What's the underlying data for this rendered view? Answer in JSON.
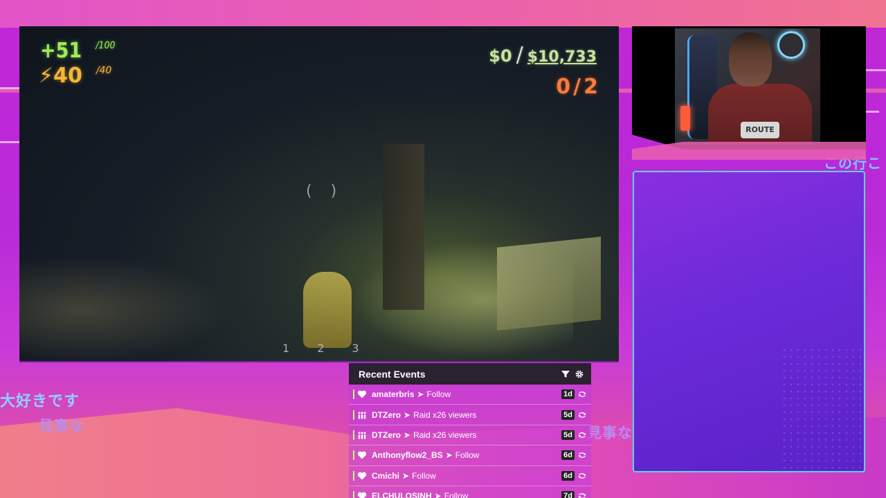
{
  "background": {
    "japanese_texts": [
      "この行こ",
      "大好きです",
      "見事な",
      "見事な"
    ]
  },
  "game": {
    "health": {
      "value": "+51",
      "max": "/100"
    },
    "energy": {
      "value": "⚡40",
      "max": "/40"
    },
    "money": {
      "current": "$0",
      "total": "$10,733"
    },
    "objective": "0/2",
    "crosshair": "( )",
    "slots": [
      "1",
      "2",
      "3"
    ]
  },
  "webcam": {
    "shirt_text": "ROUTE"
  },
  "events": {
    "title": "Recent Events",
    "items": [
      {
        "name": "amaterbris",
        "detail": "Follow",
        "age": "1d",
        "type": "follow"
      },
      {
        "name": "DTZero",
        "detail": "Raid x26 viewers",
        "age": "5d",
        "type": "raid"
      },
      {
        "name": "DTZero",
        "detail": "Raid x26 viewers",
        "age": "5d",
        "type": "raid"
      },
      {
        "name": "Anthonyflow2_BS",
        "detail": "Follow",
        "age": "6d",
        "type": "follow"
      },
      {
        "name": "Cmichi",
        "detail": "Follow",
        "age": "6d",
        "type": "follow"
      },
      {
        "name": "ELCHULOSINH",
        "detail": "Follow",
        "age": "7d",
        "type": "follow"
      }
    ]
  },
  "colors": {
    "health": "#a6e85a",
    "energy": "#f2b73a",
    "objective": "#ff7a3c",
    "panel_border": "#5ed4e6"
  }
}
